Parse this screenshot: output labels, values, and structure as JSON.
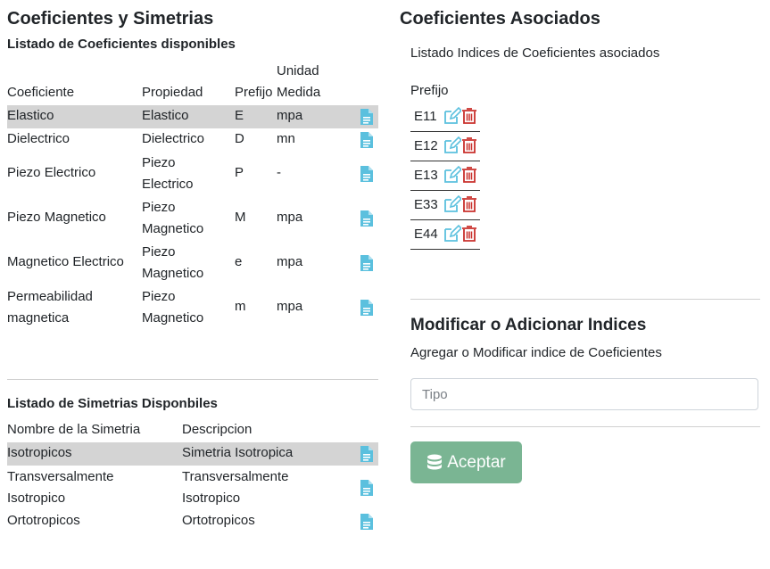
{
  "left": {
    "title": "Coeficientes y Simetrias",
    "coef_list_title": "Listado de Coeficientes disponibles",
    "coef_headers": {
      "coeficiente": "Coeficiente",
      "propiedad": "Propiedad",
      "prefijo": "Prefijo",
      "unidad_medida_1": "Unidad",
      "unidad_medida_2": "Medida"
    },
    "coef_rows": [
      {
        "coef": [
          "Elastico"
        ],
        "prop": [
          "Elastico"
        ],
        "prefijo": "E",
        "unidad": "mpa",
        "selected": true
      },
      {
        "coef": [
          "Dielectrico"
        ],
        "prop": [
          "Dielectrico"
        ],
        "prefijo": "D",
        "unidad": "mn",
        "selected": false
      },
      {
        "coef": [
          "Piezo Electrico"
        ],
        "prop": [
          "Piezo",
          "Electrico"
        ],
        "prefijo": "P",
        "unidad": "-",
        "selected": false
      },
      {
        "coef": [
          "Piezo Magnetico"
        ],
        "prop": [
          "Piezo",
          "Magnetico"
        ],
        "prefijo": "M",
        "unidad": "mpa",
        "selected": false
      },
      {
        "coef": [
          "Magnetico Electrico"
        ],
        "prop": [
          "Piezo",
          "Magnetico"
        ],
        "prefijo": "e",
        "unidad": "mpa",
        "selected": false
      },
      {
        "coef": [
          "Permeabilidad",
          "magnetica"
        ],
        "prop": [
          "Piezo",
          "Magnetico"
        ],
        "prefijo": "m",
        "unidad": "mpa",
        "selected": false
      }
    ],
    "sim_list_title": "Listado de Simetrias Disponbiles",
    "sim_headers": {
      "nombre": "Nombre de la Simetria",
      "descripcion": "Descripcion"
    },
    "sim_rows": [
      {
        "nombre": [
          "Isotropicos"
        ],
        "descripcion": [
          "Simetria Isotropica"
        ],
        "selected": true
      },
      {
        "nombre": [
          "Transversalmente",
          "Isotropico"
        ],
        "descripcion": [
          "Transversalmente",
          "Isotropico"
        ],
        "selected": false
      },
      {
        "nombre": [
          "Ortotropicos"
        ],
        "descripcion": [
          "Ortotropicos"
        ],
        "selected": false
      }
    ]
  },
  "right": {
    "title": "Coeficientes Asociados",
    "subtitle": "Listado Indices de Coeficientes asociados",
    "prefijo_header": "Prefijo",
    "prefijos": [
      "E11",
      "E12",
      "E13",
      "E33",
      "E44"
    ],
    "form_title": "Modificar o Adicionar Indices",
    "form_subtitle": "Agregar o Modificar indice de Coeficientes",
    "tipo_placeholder": "Tipo",
    "tipo_value": "",
    "accept_label": "Aceptar"
  },
  "colors": {
    "selected_row": "#d4d4d4",
    "doc_icon": "#5bc0de",
    "edit_icon": "#5bc0de",
    "trash_icon": "#c9302c",
    "accept_button": "#7ab593"
  },
  "icons": {
    "document": "document-icon",
    "edit": "edit-icon",
    "trash": "trash-icon",
    "database": "database-icon"
  }
}
